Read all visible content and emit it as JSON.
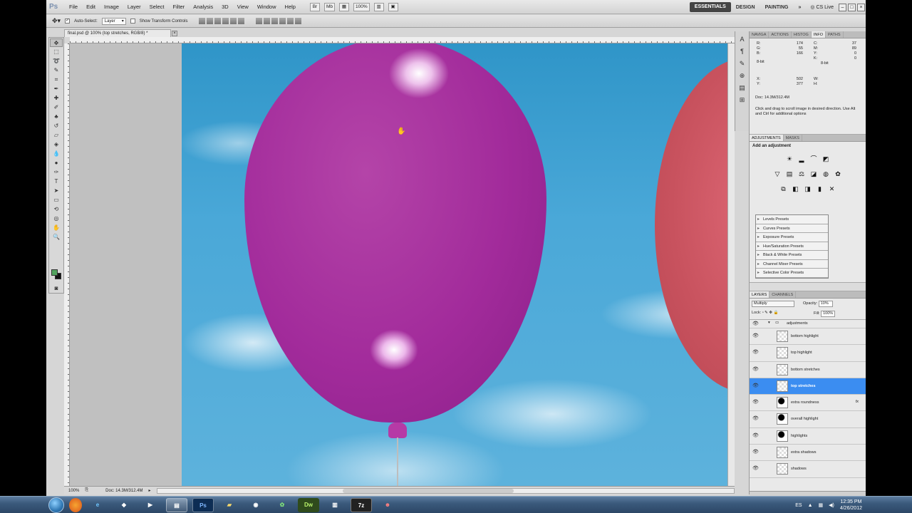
{
  "app": {
    "logo": "Ps",
    "menus": [
      "File",
      "Edit",
      "Image",
      "Layer",
      "Select",
      "Filter",
      "Analysis",
      "3D",
      "View",
      "Window",
      "Help"
    ],
    "zoom_select": "100%",
    "workspaces": [
      "ESSENTIALS",
      "DESIGN",
      "PAINTING"
    ],
    "more_label": "»",
    "cs_live": "CS Live"
  },
  "options_bar": {
    "auto_select_label": "Auto-Select:",
    "auto_select_value": "Layer",
    "transform_label": "Show Transform Controls"
  },
  "document": {
    "tab_title": "final.psd @ 100% (top stretches, RGB/8) *",
    "zoom": "100%",
    "doc_size": "Doc: 14.3M/312.4M"
  },
  "info_panel": {
    "tabs": [
      "NAVIGA",
      "ACTIONS",
      "HISTOG",
      "INFO",
      "PATHS"
    ],
    "active_tab": "INFO",
    "rgb": {
      "R": "174",
      "G": "55",
      "B": "166"
    },
    "cmyk": {
      "C": "37",
      "M": "89",
      "Y": "0",
      "K": "0"
    },
    "bit_left": "8-bit",
    "bit_right": "8-bit",
    "x": "502",
    "y": "377",
    "doc": "Doc: 14.3M/312.4M",
    "message": "Click and drag to scroll image in desired direction. Use Alt and Ctrl for additional options"
  },
  "adjustments_panel": {
    "tabs": [
      "ADJUSTMENTS",
      "MASKS"
    ],
    "title": "Add an adjustment",
    "presets": [
      "Levels Presets",
      "Curves Presets",
      "Exposure Presets",
      "Hue/Saturation Presets",
      "Black & White Presets",
      "Channel Mixer Presets",
      "Selective Color Presets"
    ]
  },
  "layers_panel": {
    "tabs": [
      "LAYERS",
      "CHANNELS"
    ],
    "blend_mode": "Multiply",
    "opacity_label": "Opacity:",
    "opacity": "10%",
    "lock_label": "Lock:",
    "fill_label": "Fill:",
    "fill": "100%",
    "group": "adjustments",
    "layers": [
      {
        "name": "bottom highlight",
        "mask": false,
        "fx": false,
        "selected": false
      },
      {
        "name": "top highlight",
        "mask": false,
        "fx": false,
        "selected": false
      },
      {
        "name": "bottom stretches",
        "mask": false,
        "fx": false,
        "selected": false
      },
      {
        "name": "top stretches",
        "mask": false,
        "fx": false,
        "selected": true
      },
      {
        "name": "extra roundness",
        "mask": true,
        "fx": true,
        "selected": false
      },
      {
        "name": "overall highlight",
        "mask": true,
        "fx": false,
        "selected": false
      },
      {
        "name": "highlights",
        "mask": true,
        "fx": false,
        "selected": false
      },
      {
        "name": "extra shadows",
        "mask": false,
        "fx": false,
        "selected": false
      },
      {
        "name": "shadows",
        "mask": false,
        "fx": false,
        "selected": false
      }
    ],
    "fx_label": "fx"
  },
  "taskbar": {
    "apps": [
      "Ps",
      "Dw",
      "7z"
    ],
    "lang": "ES",
    "time": "12:35 PM",
    "date": "4/26/2012"
  }
}
